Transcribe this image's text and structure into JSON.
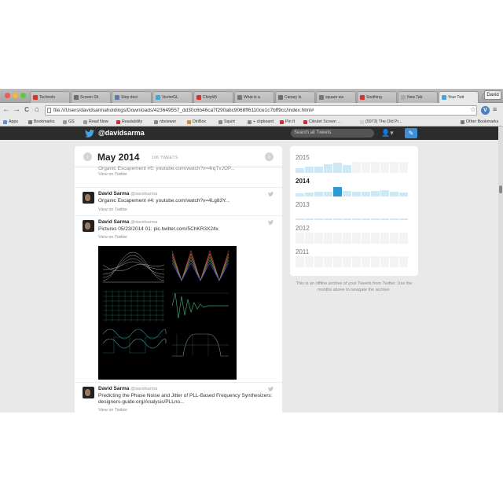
{
  "browser": {
    "tabs": [
      {
        "label": "Technolo",
        "color": "#d6332c"
      },
      {
        "label": "Screen Sh",
        "color": "#6d6d6d"
      },
      {
        "label": "Step desi",
        "color": "#5b7da8"
      },
      {
        "label": "VectorGL",
        "color": "#4aa3df"
      },
      {
        "label": "ChirpWi",
        "color": "#d6332c"
      },
      {
        "label": "What is a",
        "color": "#777777"
      },
      {
        "label": "Canary Is",
        "color": "#6d6d6d"
      },
      {
        "label": "square wa",
        "color": "#777777"
      },
      {
        "label": "Soothing",
        "color": "#d6332c"
      },
      {
        "label": "New Tab",
        "color": "#aaaaaa"
      },
      {
        "label": "Your Twit",
        "color": "#4aa3df"
      }
    ],
    "user_chip": "David",
    "url": "file:///Users/davidsarmaholdings/Downloads/423649557_dd30c6b46ca7f290abc9068ff6110ce1c7bff9cc/index.html#",
    "nav": {
      "back": "←",
      "forward": "→",
      "reload": "C",
      "home": "⌂"
    },
    "star": "☆",
    "ext_letter": "V",
    "menu": "≡",
    "bookmarks": [
      {
        "label": "Apps",
        "color": "#5a8fd6"
      },
      {
        "label": "Bookmarks",
        "color": "#777777"
      },
      {
        "label": "GS",
        "color": "#999999"
      },
      {
        "label": "Read Now",
        "color": "#999999"
      },
      {
        "label": "Readability",
        "color": "#c33333"
      },
      {
        "label": "nbviewer",
        "color": "#888888"
      },
      {
        "label": "DiriBox",
        "color": "#d08a3a"
      },
      {
        "label": "Squirt",
        "color": "#888888"
      },
      {
        "label": "+ clipboard",
        "color": "#888888"
      },
      {
        "label": "Pin It",
        "color": "#c33333"
      },
      {
        "label": "Citrulet Screen ...",
        "color": "#c33333"
      },
      {
        "label": "(5973) The Old Pr...",
        "color": "#d0d0d0"
      },
      {
        "label": "Other Bookmarks",
        "color": "#777777"
      }
    ]
  },
  "twitter": {
    "handle": "@davidsarma",
    "search_placeholder": "Search all Tweets",
    "user_icon": "👤▾",
    "compose_icon": "✎"
  },
  "timeline": {
    "month": "May 2014",
    "count": "106 TWEETS",
    "prev": "‹",
    "next": "›",
    "partial_text": "Organic Escapement #5: youtube.com/watch?v=4rqTvJOP...",
    "partial_link": "View on Twitter",
    "tweets": [
      {
        "name": "David Sarma",
        "screen_name": "@davidsarma",
        "text": "Organic Escapement #4: youtube.com/watch?v=4Lg83Y...",
        "link": "View on Twitter"
      },
      {
        "name": "David Sarma",
        "screen_name": "@davidsarma",
        "text": "Pictures 05/23/2014 01: pic.twitter.com/5ChKR3X24x",
        "link": "View on Twitter"
      },
      {
        "name": "David Sarma",
        "screen_name": "@davidsarma",
        "text": "Predicting the Phase Noise and Jitter of PLL-Based Frequency Synthesizers: designers-guide.org/Analysis/PLLno...",
        "link": "View on Twitter"
      }
    ]
  },
  "archive": {
    "years": [
      {
        "year": "2015",
        "current": false,
        "months": [
          0.45,
          0.55,
          0.6,
          0.8,
          0.95,
          0.7,
          0,
          0,
          0,
          0,
          0,
          0
        ]
      },
      {
        "year": "2014",
        "current": true,
        "selected_month": 4,
        "months": [
          0.3,
          0.35,
          0.4,
          0.45,
          0.85,
          0.5,
          0.45,
          0.4,
          0.5,
          0.6,
          0.45,
          0.35
        ]
      },
      {
        "year": "2013",
        "current": false,
        "months": [
          0.15,
          0.15,
          0.15,
          0.15,
          0.15,
          0.15,
          0.15,
          0.15,
          0.15,
          0.15,
          0.15,
          0.15
        ]
      },
      {
        "year": "2012",
        "current": false,
        "months": [
          0,
          0,
          0,
          0,
          0,
          0,
          0,
          0,
          0,
          0,
          0,
          0
        ]
      },
      {
        "year": "2011",
        "current": false,
        "months": [
          0,
          0,
          0,
          0,
          0,
          0,
          0,
          0,
          0,
          0,
          0,
          0
        ]
      }
    ],
    "note": "This is an offline archive of your Tweets from Twitter. Use the months above to navigate the archive."
  },
  "colors": {
    "twitter_blue": "#2f99d1",
    "topbar": "#2c2c2c",
    "bar_light": "#cfe9f4"
  }
}
